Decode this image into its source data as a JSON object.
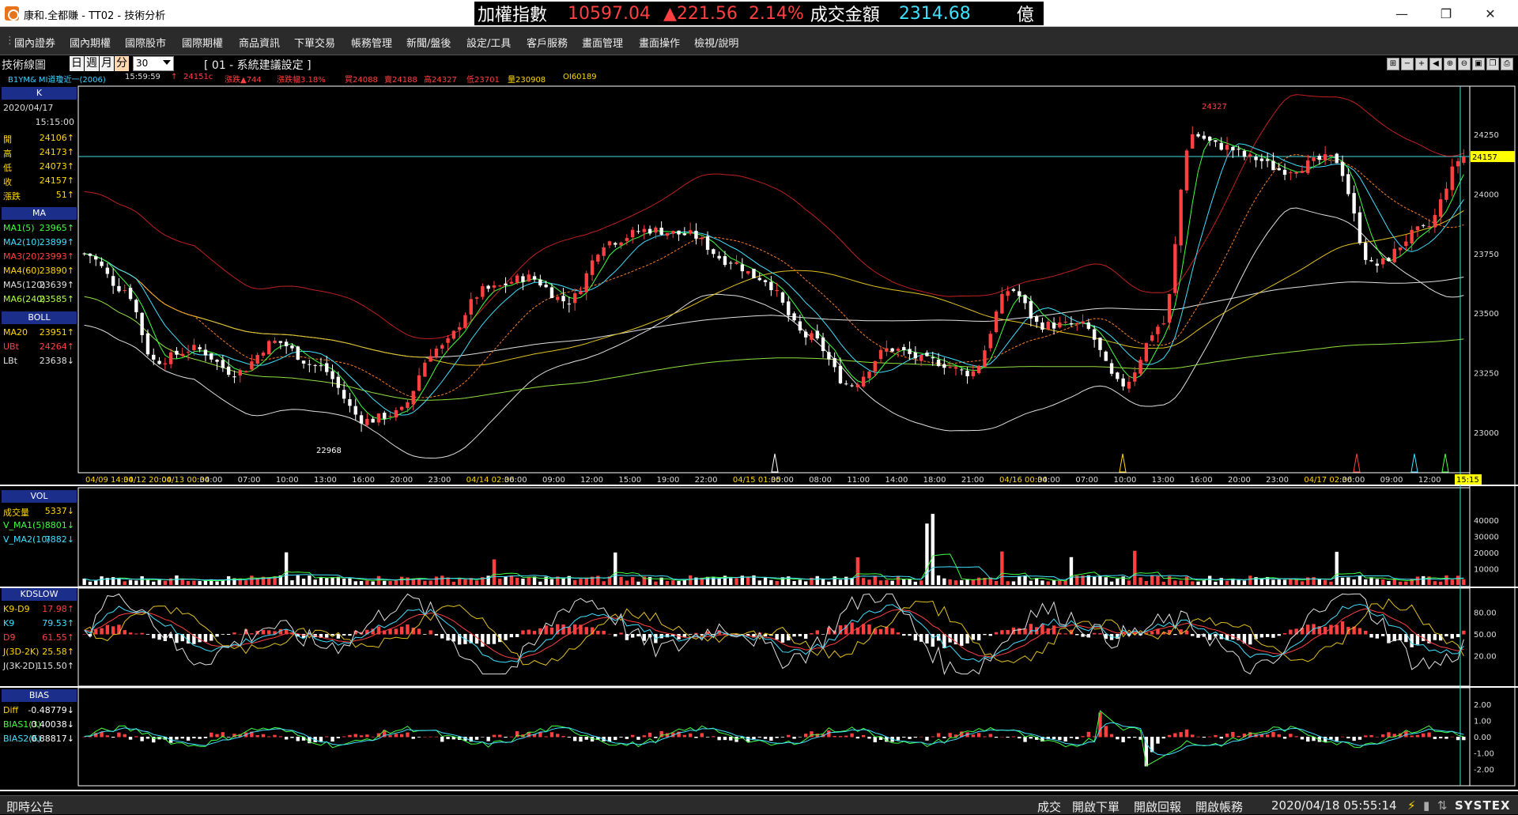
{
  "window": {
    "title": "康和.全都賺 - TT02 - 技術分析",
    "ticker_name": "加權指數",
    "ticker_price": "10597.04",
    "ticker_change": "▲221.56",
    "ticker_pct": "2.14%",
    "turnover_label": "成交金額",
    "turnover_value": "2314.68",
    "turnover_unit": "億"
  },
  "menu": [
    "國內證券",
    "國內期權",
    "國際股市",
    "國際期權",
    "商品資訊",
    "下單交易",
    "帳務管理",
    "新聞/盤後",
    "設定/工具",
    "客戶服務",
    "畫面管理",
    "畫面操作",
    "檢視/說明"
  ],
  "toolbar": {
    "chart_name": "技術線圖",
    "periods": [
      "日",
      "週",
      "月",
      "分"
    ],
    "active_period": "分",
    "interval": "30",
    "strategy": "[ 01 - 系統建議設定 ]"
  },
  "quote": {
    "symbol": "B1YM&  MI道瓊近一(2006)",
    "time": "15:59:59",
    "arrow": "↑",
    "price": "24151c",
    "change": "漲跌▲744",
    "change_pct": "漲跌幅3.18%",
    "bid": "買24088",
    "ask": "賣24188",
    "high": "高24327",
    "low": "低23701",
    "volume": "量230908",
    "oi": "OI60189"
  },
  "panel_k": {
    "header": "K",
    "date": "2020/04/17",
    "time": "15:15:00",
    "rows": [
      {
        "label": "開",
        "value": "24106↑"
      },
      {
        "label": "高",
        "value": "24173↑"
      },
      {
        "label": "低",
        "value": "24073↑"
      },
      {
        "label": "收",
        "value": "24157↑"
      },
      {
        "label": "漲跌",
        "value": "51↑"
      }
    ]
  },
  "panel_ma": {
    "header": "MA",
    "rows": [
      {
        "label": "MA1(5)",
        "value": "23965↑"
      },
      {
        "label": "MA2(10)",
        "value": "23899↑"
      },
      {
        "label": "MA3(20)",
        "value": "23993↑"
      },
      {
        "label": "MA4(60)",
        "value": "23890↑"
      },
      {
        "label": "MA5(120)",
        "value": "23639↑"
      },
      {
        "label": "MA6(240)",
        "value": "23585↑"
      }
    ]
  },
  "panel_boll": {
    "header": "BOLL",
    "rows": [
      {
        "label": "MA20",
        "value": "23951↑"
      },
      {
        "label": "UBt",
        "value": "24264↑"
      },
      {
        "label": "LBt",
        "value": "23638↓"
      }
    ]
  },
  "panel_vol": {
    "header": "VOL",
    "rows": [
      {
        "label": "成交量",
        "value": "5337↓"
      },
      {
        "label": "V_MA1(5)",
        "value": "8801↓"
      },
      {
        "label": "V_MA2(10)",
        "value": "7882↓"
      }
    ]
  },
  "panel_kd": {
    "header": "KDSLOW",
    "rows": [
      {
        "label": "K9-D9",
        "value": "17.98↑"
      },
      {
        "label": "K9",
        "value": "79.53↑"
      },
      {
        "label": "D9",
        "value": "61.55↑"
      },
      {
        "label": "J(3D-2K)",
        "value": "25.58↑"
      },
      {
        "label": "J(3K-2D)",
        "value": "115.50↑"
      }
    ]
  },
  "panel_bias": {
    "header": "BIAS",
    "rows": [
      {
        "label": "Diff",
        "value": "-0.48779↓"
      },
      {
        "label": "BIAS1(3)",
        "value": "0.40038↓"
      },
      {
        "label": "BIAS2(6)",
        "value": "0.88817↓"
      }
    ]
  },
  "chart_data": {
    "type": "candlestick",
    "y_axis": [
      "24250",
      "24000",
      "23750",
      "23500",
      "23250",
      "23000"
    ],
    "last_price_tag": "24157",
    "high_annotation": "24327",
    "low_annotation": "22968",
    "x_ticks": [
      "04/09 14:30",
      "04/12 20:00",
      "04/13 00:30",
      "04:00",
      "07:00",
      "10:00",
      "13:00",
      "16:00",
      "20:00",
      "23:00",
      "04/14 02:30",
      "06:00",
      "09:00",
      "12:00",
      "15:00",
      "19:00",
      "22:00",
      "04/15 01:30",
      "05:00",
      "08:00",
      "11:00",
      "14:00",
      "18:00",
      "21:00",
      "04/16 00:30",
      "04:00",
      "07:00",
      "10:00",
      "13:00",
      "16:00",
      "20:00",
      "23:00",
      "04/17 02:30",
      "06:00",
      "09:00",
      "12:00",
      "15:15"
    ],
    "vol_axis": [
      "40000",
      "30000",
      "20000",
      "10000"
    ],
    "kd_axis": [
      "80.00",
      "50.00",
      "20.00"
    ],
    "bias_axis": [
      "2.00",
      "1.00",
      "0.00",
      "-1.00",
      "-2.00"
    ]
  },
  "statusbar": {
    "announce": "即時公告",
    "items": [
      "成交",
      "開啟下單",
      "開啟回報",
      "開啟帳務"
    ],
    "datetime": "2020/04/18 05:55:14",
    "brand": "SYSTEX"
  }
}
